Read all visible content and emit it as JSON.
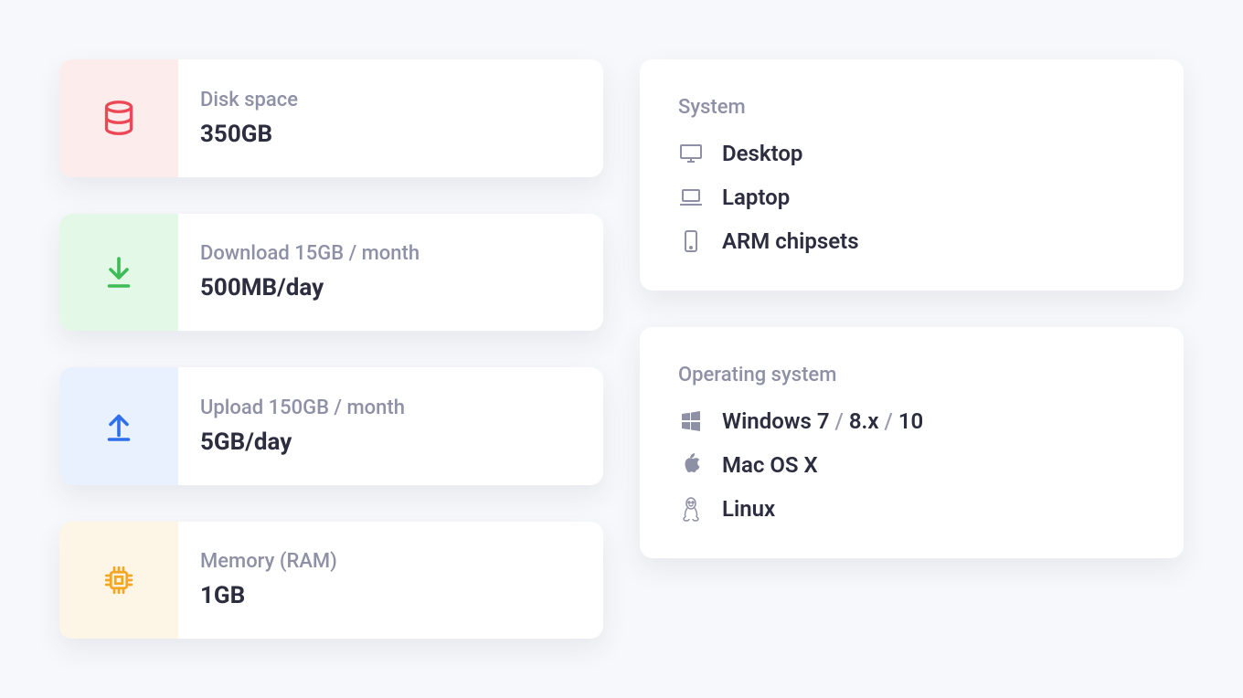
{
  "stats": [
    {
      "label": "Disk space",
      "value": "350GB"
    },
    {
      "label": "Download 15GB / month",
      "value": "500MB/day"
    },
    {
      "label": "Upload 150GB / month",
      "value": "5GB/day"
    },
    {
      "label": "Memory (RAM)",
      "value": "1GB"
    }
  ],
  "system": {
    "title": "System",
    "items": [
      "Desktop",
      "Laptop",
      "ARM chipsets"
    ]
  },
  "os": {
    "title": "Operating system",
    "windows_prefix": "Windows 7",
    "windows_sep1": " / ",
    "windows_v2": "8.x",
    "windows_sep2": " / ",
    "windows_v3": "10",
    "mac": "Mac OS X",
    "linux": "Linux"
  }
}
